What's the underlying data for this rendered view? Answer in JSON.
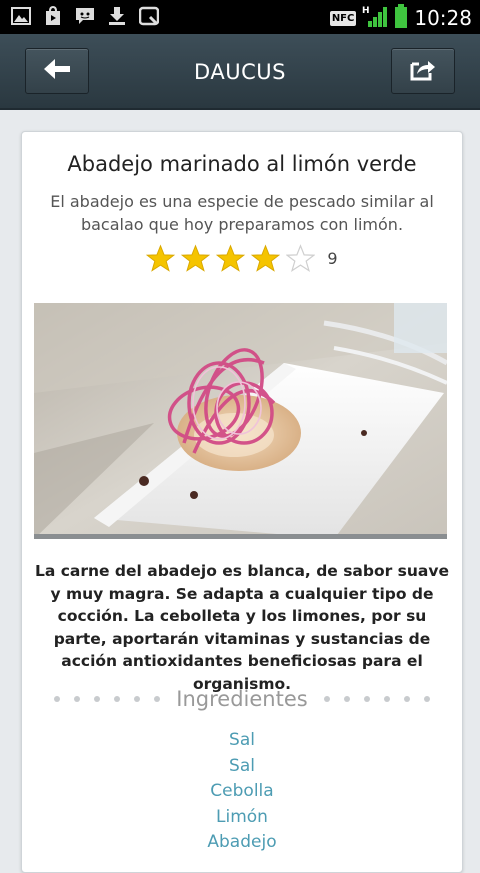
{
  "status": {
    "icons": [
      "image-icon",
      "play-store-icon",
      "chat-icon",
      "download-icon",
      "square-icon"
    ],
    "nfc": "NFC",
    "network": "H",
    "time": "10:28"
  },
  "appbar": {
    "title": "DAUCUS",
    "back_icon": "back-arrow-icon",
    "share_icon": "share-icon"
  },
  "recipe": {
    "title": "Abadejo marinado al limón verde",
    "subtitle": "El abadejo es una especie de pescado similar al bacalao que hoy preparamos con limón.",
    "rating": 4,
    "rating_max": 5,
    "rating_count": "9",
    "image_desc": "marinated cod with red onion on a white plate",
    "description": "La carne del abadejo es blanca, de sabor suave y muy magra. Se adapta a cualquier tipo de cocción. La cebolleta y los limones, por su parte, aportarán vitaminas y sustancias de acción antioxidantes beneficiosas para el organismo.",
    "ingredients_title": "Ingredientes",
    "ingredients": [
      "Sal",
      "Sal",
      "Cebolla",
      "Limón",
      "Abadejo"
    ]
  },
  "colors": {
    "appbar": "#34444d",
    "ingredient_link": "#4d9cb3",
    "star": "#f5c400",
    "status_green": "#3fc43f"
  }
}
